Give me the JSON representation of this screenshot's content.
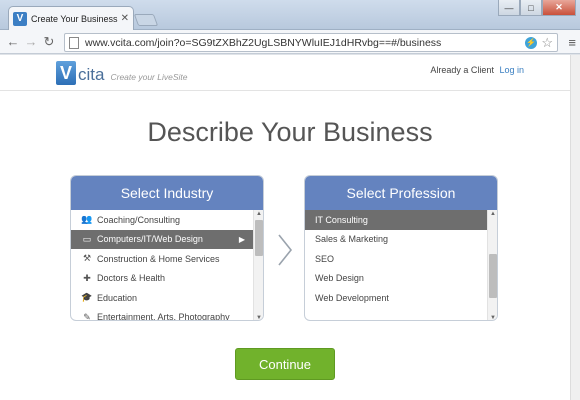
{
  "browser": {
    "tab_title": "Create Your Business Acc",
    "url": "www.vcita.com/join?o=SG9tZXBhZ2UgLSBNYWluIEJ1dHRvbg==#/business",
    "win_min": "—",
    "win_max": "□",
    "win_close": "✕",
    "tab_close": "✕",
    "back": "←",
    "forward": "→",
    "reload": "↻",
    "star": "☆",
    "menu": "≡",
    "ext": "⚡"
  },
  "header": {
    "logo_letter": "V",
    "logo_text": "cita",
    "tagline": "Create your LiveSite",
    "client_text": "Already a Client",
    "login_label": "Log in"
  },
  "headline": "Describe Your Business",
  "industry": {
    "title": "Select Industry",
    "items": [
      {
        "label": "Coaching/Consulting",
        "icon": "people-icon",
        "glyph": "👥"
      },
      {
        "label": "Computers/IT/Web Design",
        "icon": "monitor-icon",
        "glyph": "▭"
      },
      {
        "label": "Construction & Home Services",
        "icon": "hammer-icon",
        "glyph": "⚒"
      },
      {
        "label": "Doctors & Health",
        "icon": "medical-kit-icon",
        "glyph": "✚"
      },
      {
        "label": "Education",
        "icon": "graduation-cap-icon",
        "glyph": "🎓"
      },
      {
        "label": "Entertainment, Arts, Photography",
        "icon": "brush-icon",
        "glyph": "✎"
      }
    ],
    "selected_index": 1,
    "selected_arrow": "▶"
  },
  "profession": {
    "title": "Select Profession",
    "items": [
      {
        "label": "IT Consulting"
      },
      {
        "label": "Sales & Marketing"
      },
      {
        "label": "SEO"
      },
      {
        "label": "Web Design"
      },
      {
        "label": "Web Development"
      }
    ],
    "selected_index": 0
  },
  "continue_label": "Continue",
  "colors": {
    "panel_header": "#6483bf",
    "continue": "#71b22c",
    "selected_row": "#6e6e6e",
    "login_link": "#3a7fc1"
  }
}
